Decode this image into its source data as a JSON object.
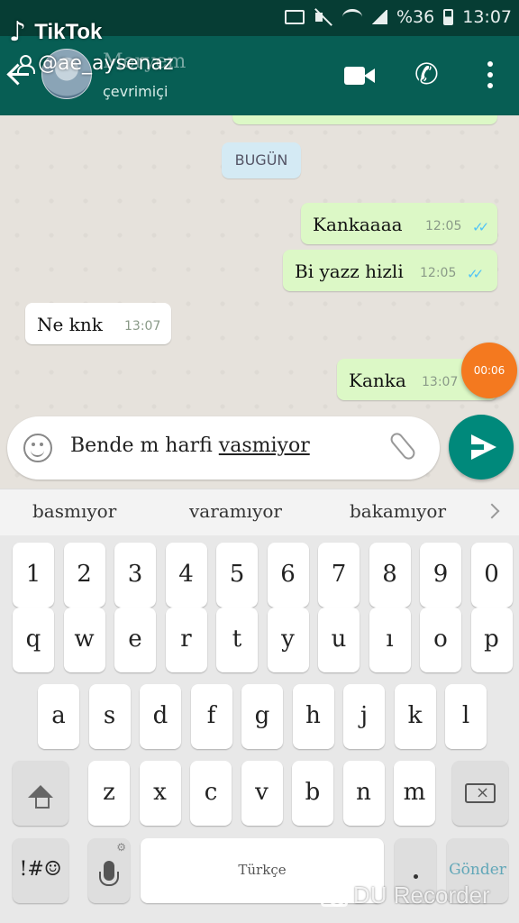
{
  "status_bar": {
    "battery": "%36",
    "time": "13:07"
  },
  "watermark": {
    "brand": "TikTok",
    "handle": "@ae_aysenaz"
  },
  "header": {
    "contact_name": "Meryem",
    "contact_status": "çevrimiçi"
  },
  "chat": {
    "date_chip": "BUGÜN",
    "messages": [
      {
        "direction": "out",
        "text": "Kankaaaa",
        "time": "12:05"
      },
      {
        "direction": "out",
        "text": "Bi yazz hizli",
        "time": "12:05"
      },
      {
        "direction": "in",
        "text": "Ne knk",
        "time": "13:07"
      },
      {
        "direction": "out",
        "text": "Kanka",
        "time": "13:07"
      }
    ],
    "recording_timer": "00:06"
  },
  "composer": {
    "text_prefix": "Bende m harfi ",
    "text_composing": "vasmiyor"
  },
  "suggestions": [
    "basmıyor",
    "varamıyor",
    "bakamıyor"
  ],
  "keyboard": {
    "row_numbers": [
      "1",
      "2",
      "3",
      "4",
      "5",
      "6",
      "7",
      "8",
      "9",
      "0"
    ],
    "row_1": [
      "q",
      "w",
      "e",
      "r",
      "t",
      "y",
      "u",
      "ı",
      "o",
      "p"
    ],
    "row_2": [
      "a",
      "s",
      "d",
      "f",
      "g",
      "h",
      "j",
      "k",
      "l"
    ],
    "row_3": [
      "z",
      "x",
      "c",
      "v",
      "b",
      "n",
      "m"
    ],
    "symbols_key": "!#☺",
    "space_label": "Türkçe",
    "send_key": "Gönder"
  },
  "recorder": {
    "label": "DU Recorder"
  },
  "colors": {
    "header": "#075e54",
    "outgoing_bubble": "#dcf8c6",
    "send_button": "#00897b",
    "timer": "#f4791f"
  }
}
